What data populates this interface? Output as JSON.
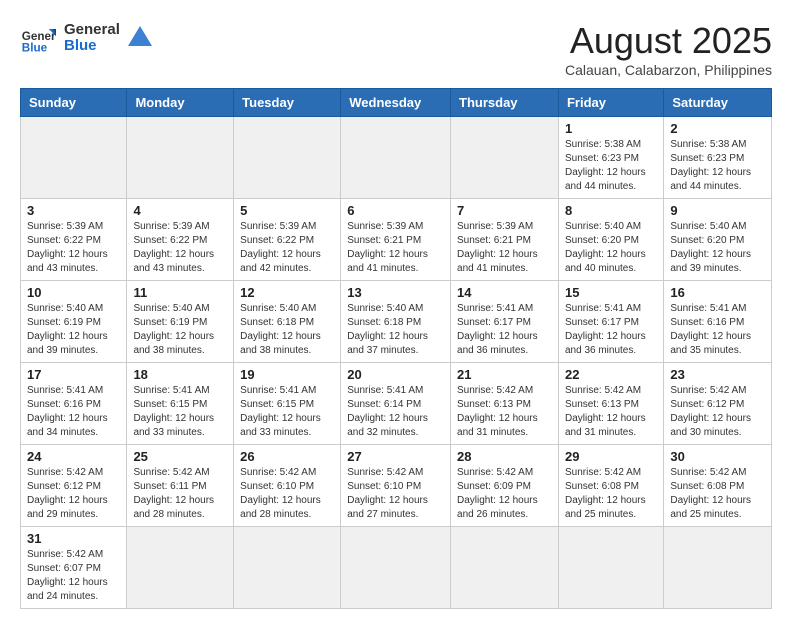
{
  "header": {
    "logo_general": "General",
    "logo_blue": "Blue",
    "title": "August 2025",
    "subtitle": "Calauan, Calabarzon, Philippines"
  },
  "weekdays": [
    "Sunday",
    "Monday",
    "Tuesday",
    "Wednesday",
    "Thursday",
    "Friday",
    "Saturday"
  ],
  "weeks": [
    [
      {
        "day": "",
        "info": ""
      },
      {
        "day": "",
        "info": ""
      },
      {
        "day": "",
        "info": ""
      },
      {
        "day": "",
        "info": ""
      },
      {
        "day": "",
        "info": ""
      },
      {
        "day": "1",
        "info": "Sunrise: 5:38 AM\nSunset: 6:23 PM\nDaylight: 12 hours and 44 minutes."
      },
      {
        "day": "2",
        "info": "Sunrise: 5:38 AM\nSunset: 6:23 PM\nDaylight: 12 hours and 44 minutes."
      }
    ],
    [
      {
        "day": "3",
        "info": "Sunrise: 5:39 AM\nSunset: 6:22 PM\nDaylight: 12 hours and 43 minutes."
      },
      {
        "day": "4",
        "info": "Sunrise: 5:39 AM\nSunset: 6:22 PM\nDaylight: 12 hours and 43 minutes."
      },
      {
        "day": "5",
        "info": "Sunrise: 5:39 AM\nSunset: 6:22 PM\nDaylight: 12 hours and 42 minutes."
      },
      {
        "day": "6",
        "info": "Sunrise: 5:39 AM\nSunset: 6:21 PM\nDaylight: 12 hours and 41 minutes."
      },
      {
        "day": "7",
        "info": "Sunrise: 5:39 AM\nSunset: 6:21 PM\nDaylight: 12 hours and 41 minutes."
      },
      {
        "day": "8",
        "info": "Sunrise: 5:40 AM\nSunset: 6:20 PM\nDaylight: 12 hours and 40 minutes."
      },
      {
        "day": "9",
        "info": "Sunrise: 5:40 AM\nSunset: 6:20 PM\nDaylight: 12 hours and 39 minutes."
      }
    ],
    [
      {
        "day": "10",
        "info": "Sunrise: 5:40 AM\nSunset: 6:19 PM\nDaylight: 12 hours and 39 minutes."
      },
      {
        "day": "11",
        "info": "Sunrise: 5:40 AM\nSunset: 6:19 PM\nDaylight: 12 hours and 38 minutes."
      },
      {
        "day": "12",
        "info": "Sunrise: 5:40 AM\nSunset: 6:18 PM\nDaylight: 12 hours and 38 minutes."
      },
      {
        "day": "13",
        "info": "Sunrise: 5:40 AM\nSunset: 6:18 PM\nDaylight: 12 hours and 37 minutes."
      },
      {
        "day": "14",
        "info": "Sunrise: 5:41 AM\nSunset: 6:17 PM\nDaylight: 12 hours and 36 minutes."
      },
      {
        "day": "15",
        "info": "Sunrise: 5:41 AM\nSunset: 6:17 PM\nDaylight: 12 hours and 36 minutes."
      },
      {
        "day": "16",
        "info": "Sunrise: 5:41 AM\nSunset: 6:16 PM\nDaylight: 12 hours and 35 minutes."
      }
    ],
    [
      {
        "day": "17",
        "info": "Sunrise: 5:41 AM\nSunset: 6:16 PM\nDaylight: 12 hours and 34 minutes."
      },
      {
        "day": "18",
        "info": "Sunrise: 5:41 AM\nSunset: 6:15 PM\nDaylight: 12 hours and 33 minutes."
      },
      {
        "day": "19",
        "info": "Sunrise: 5:41 AM\nSunset: 6:15 PM\nDaylight: 12 hours and 33 minutes."
      },
      {
        "day": "20",
        "info": "Sunrise: 5:41 AM\nSunset: 6:14 PM\nDaylight: 12 hours and 32 minutes."
      },
      {
        "day": "21",
        "info": "Sunrise: 5:42 AM\nSunset: 6:13 PM\nDaylight: 12 hours and 31 minutes."
      },
      {
        "day": "22",
        "info": "Sunrise: 5:42 AM\nSunset: 6:13 PM\nDaylight: 12 hours and 31 minutes."
      },
      {
        "day": "23",
        "info": "Sunrise: 5:42 AM\nSunset: 6:12 PM\nDaylight: 12 hours and 30 minutes."
      }
    ],
    [
      {
        "day": "24",
        "info": "Sunrise: 5:42 AM\nSunset: 6:12 PM\nDaylight: 12 hours and 29 minutes."
      },
      {
        "day": "25",
        "info": "Sunrise: 5:42 AM\nSunset: 6:11 PM\nDaylight: 12 hours and 28 minutes."
      },
      {
        "day": "26",
        "info": "Sunrise: 5:42 AM\nSunset: 6:10 PM\nDaylight: 12 hours and 28 minutes."
      },
      {
        "day": "27",
        "info": "Sunrise: 5:42 AM\nSunset: 6:10 PM\nDaylight: 12 hours and 27 minutes."
      },
      {
        "day": "28",
        "info": "Sunrise: 5:42 AM\nSunset: 6:09 PM\nDaylight: 12 hours and 26 minutes."
      },
      {
        "day": "29",
        "info": "Sunrise: 5:42 AM\nSunset: 6:08 PM\nDaylight: 12 hours and 25 minutes."
      },
      {
        "day": "30",
        "info": "Sunrise: 5:42 AM\nSunset: 6:08 PM\nDaylight: 12 hours and 25 minutes."
      }
    ],
    [
      {
        "day": "31",
        "info": "Sunrise: 5:42 AM\nSunset: 6:07 PM\nDaylight: 12 hours and 24 minutes."
      },
      {
        "day": "",
        "info": ""
      },
      {
        "day": "",
        "info": ""
      },
      {
        "day": "",
        "info": ""
      },
      {
        "day": "",
        "info": ""
      },
      {
        "day": "",
        "info": ""
      },
      {
        "day": "",
        "info": ""
      }
    ]
  ]
}
